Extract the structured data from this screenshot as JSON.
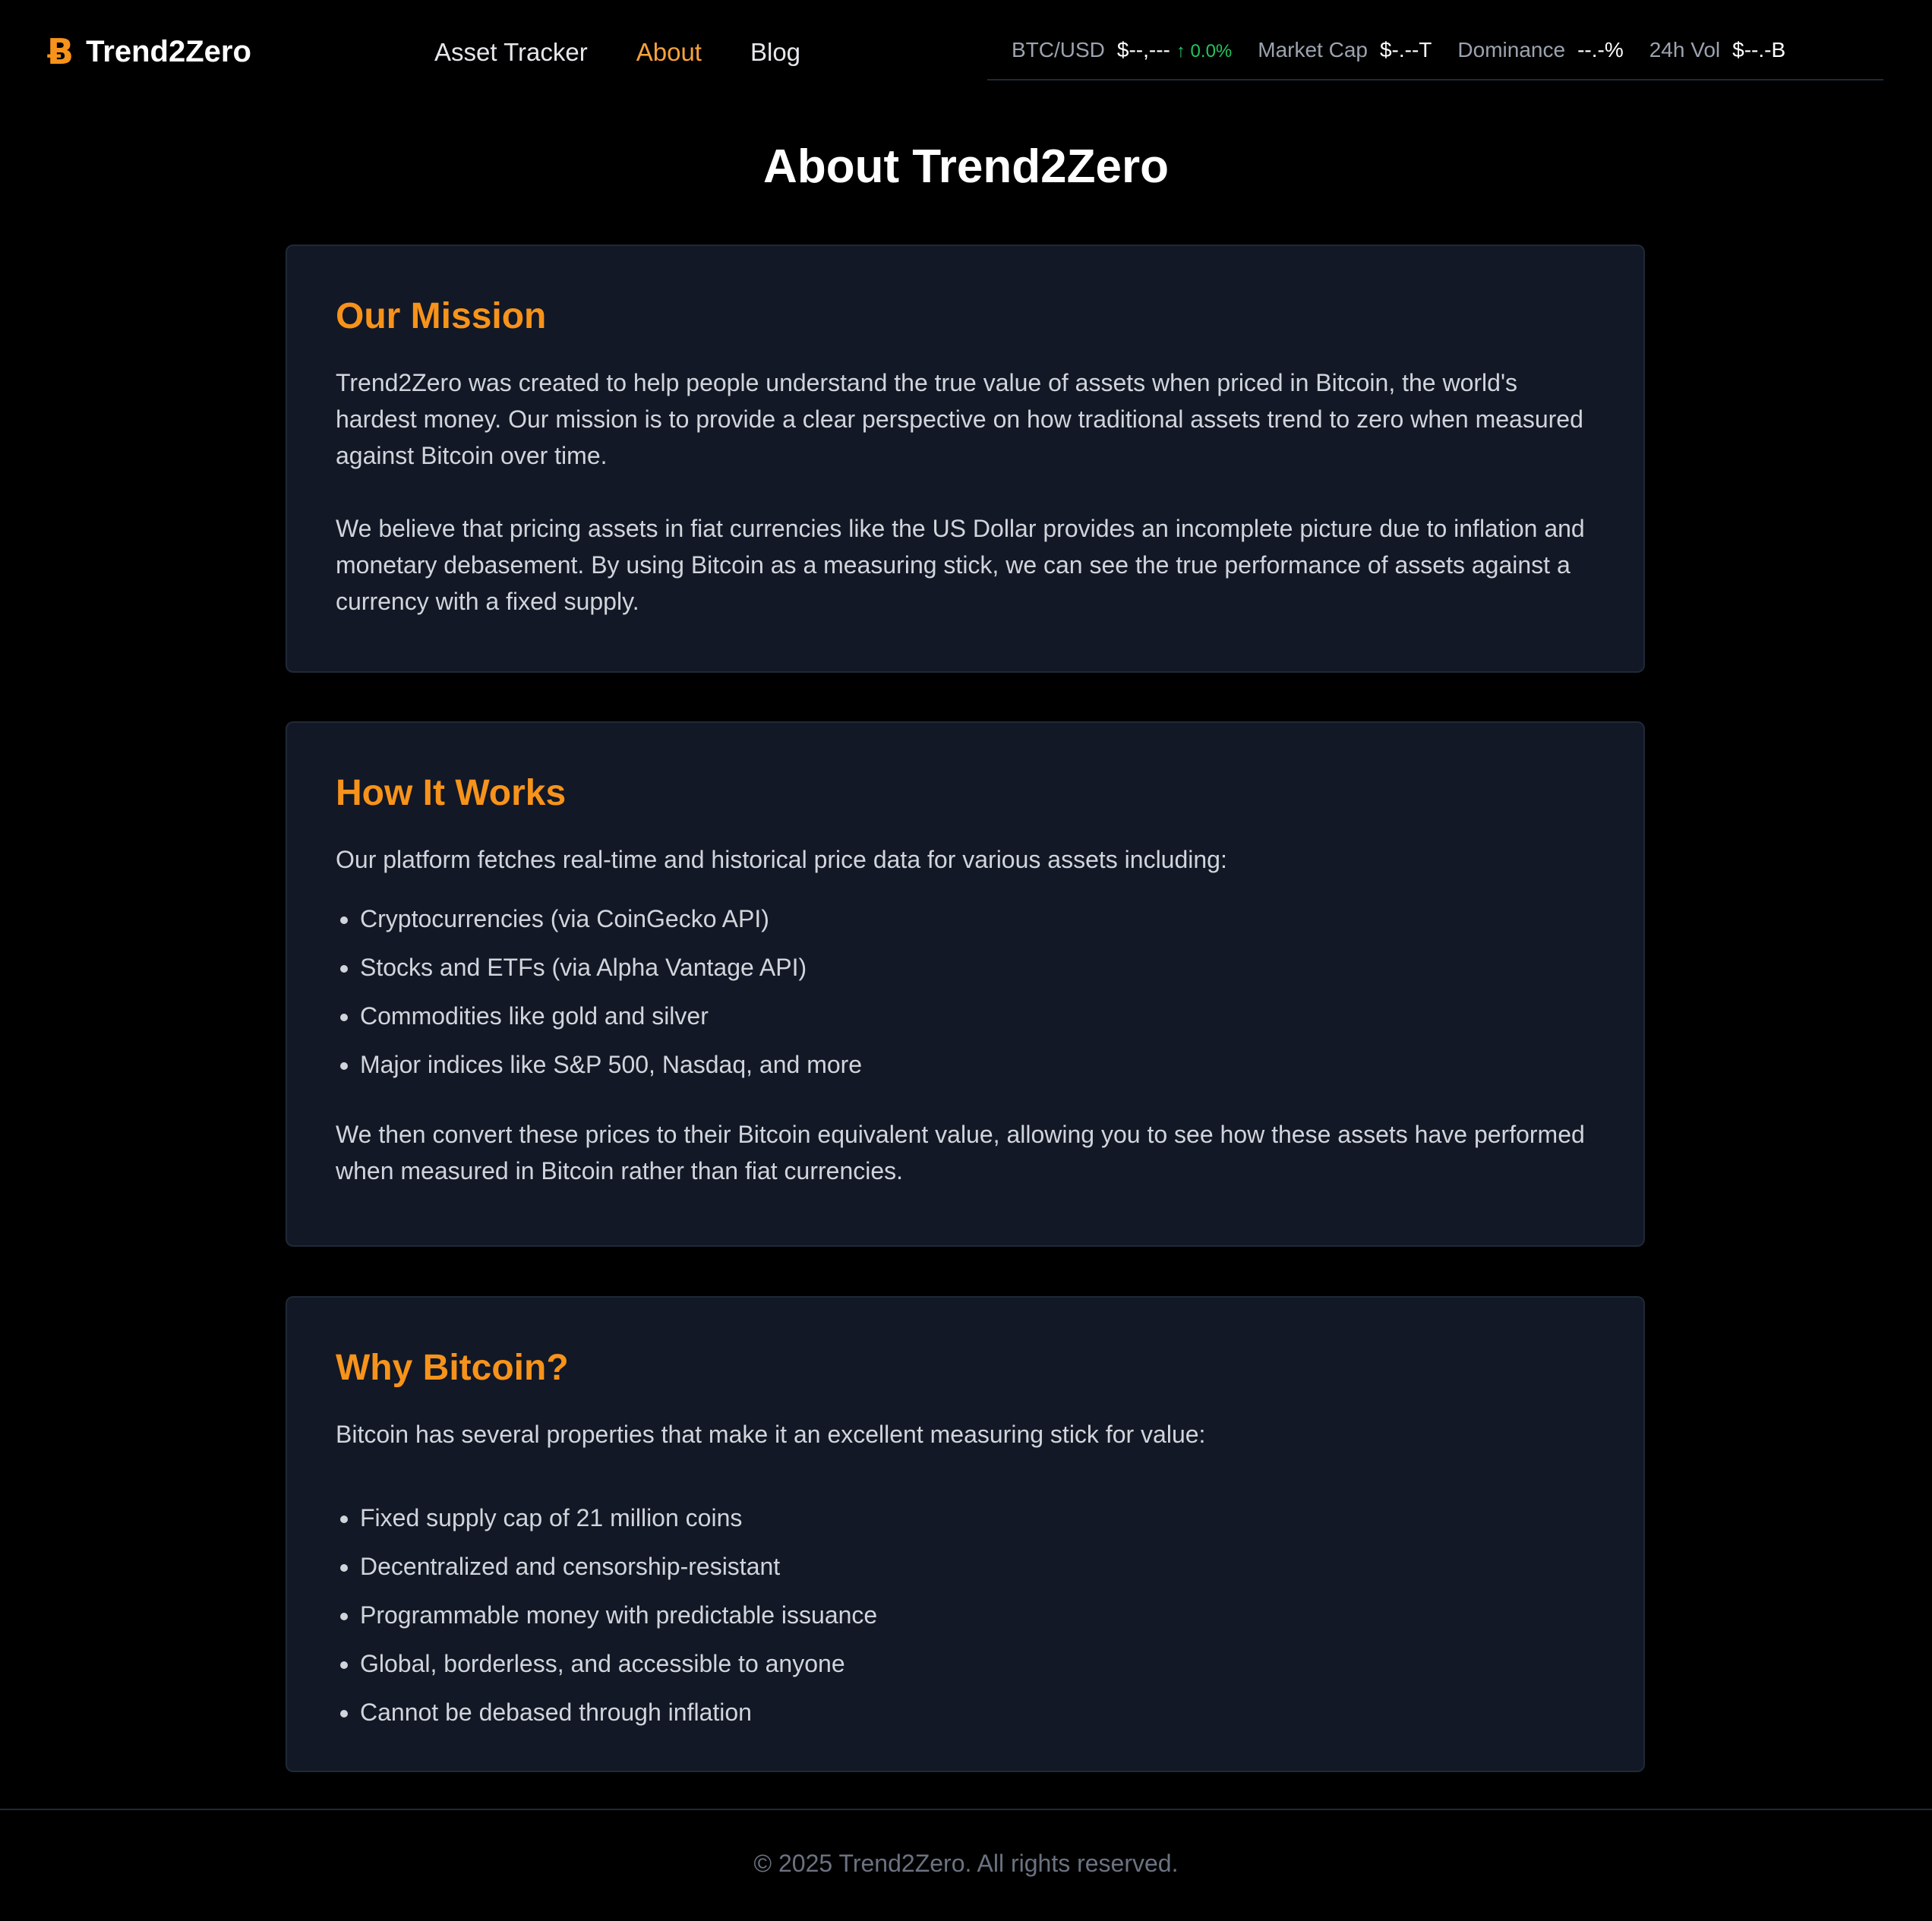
{
  "header": {
    "logo_icon": "Ƀ",
    "logo_icon_name": "bitcoin-icon",
    "brand": "Trend2Zero",
    "nav": [
      {
        "label": "Asset Tracker",
        "active": false
      },
      {
        "label": "About",
        "active": true
      },
      {
        "label": "Blog",
        "active": false
      }
    ]
  },
  "ticker": {
    "btc_label": "BTC/USD",
    "btc_value": "$--,---",
    "btc_change": "↑ 0.0%",
    "market_cap_label": "Market Cap",
    "market_cap_value": "$-.--T",
    "dominance_label": "Dominance",
    "dominance_value": "--.-%",
    "volume_label": "24h Vol",
    "volume_value": "$--.-B"
  },
  "page": {
    "title": "About Trend2Zero"
  },
  "mission": {
    "heading": "Our Mission",
    "paragraphs": [
      "Trend2Zero was created to help people understand the true value of assets when priced in Bitcoin, the world's hardest money. Our mission is to provide a clear perspective on how traditional assets trend to zero when measured against Bitcoin over time.",
      "We believe that pricing assets in fiat currencies like the US Dollar provides an incomplete picture due to inflation and monetary debasement. By using Bitcoin as a measuring stick, we can see the true performance of assets against a currency with a fixed supply."
    ]
  },
  "how": {
    "heading": "How It Works",
    "intro": "Our platform fetches real-time and historical price data for various assets including:",
    "items": [
      "Cryptocurrencies (via CoinGecko API)",
      "Stocks and ETFs (via Alpha Vantage API)",
      "Commodities like gold and silver",
      "Major indices like S&P 500, Nasdaq, and more"
    ],
    "outro": "We then convert these prices to their Bitcoin equivalent value, allowing you to see how these assets have performed when measured in Bitcoin rather than fiat currencies."
  },
  "why": {
    "heading": "Why Bitcoin?",
    "intro": "Bitcoin has several properties that make it an excellent measuring stick for value:",
    "items": [
      "Fixed supply cap of 21 million coins",
      "Decentralized and censorship-resistant",
      "Programmable money with predictable issuance",
      "Global, borderless, and accessible to anyone",
      "Cannot be debased through inflation"
    ]
  },
  "footer": {
    "text": "© 2025 Trend2Zero. All rights reserved."
  },
  "colors": {
    "accent": "#f7931a",
    "nav_active": "#f7a23b",
    "card_bg": "#121826",
    "positive": "#22c55e",
    "page_bg": "#000000"
  }
}
